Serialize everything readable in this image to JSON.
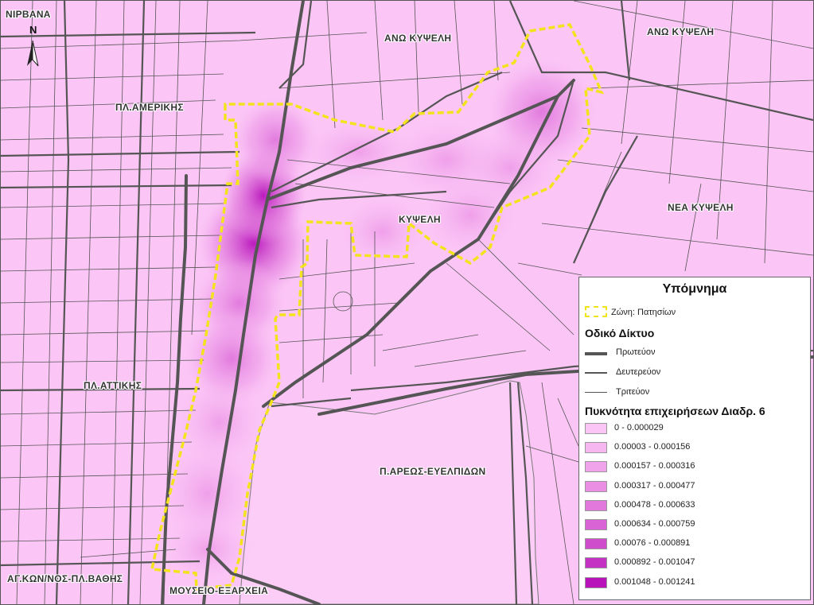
{
  "map": {
    "place_labels": [
      {
        "text": "ΝΙΡΒΑΝΑ",
        "id": "nirvana"
      },
      {
        "text": "ΑΝΩ ΚΥΨΕΛΗ",
        "id": "ano-kypseli-1"
      },
      {
        "text": "ΑΝΩ ΚΥΨΕΛΗ",
        "id": "ano-kypseli-2"
      },
      {
        "text": "ΠΛ.ΑΜΕΡΙΚΗΣ",
        "id": "pl-amerikis"
      },
      {
        "text": "ΚΥΨΕΛΗ",
        "id": "kypseli"
      },
      {
        "text": "ΝΕΑ ΚΥΨΕΛΗ",
        "id": "nea-kypseli"
      },
      {
        "text": "ΠΛ.ΑΤΤΙΚΗΣ",
        "id": "pl-attikis"
      },
      {
        "text": "Π.ΑΡΕΩΣ-ΕΥΕΛΠΙΔΩΝ",
        "id": "p-areos"
      },
      {
        "text": "ΑΓ.ΚΩΝ/ΝΟΣ-ΠΛ.ΒΑΘΗΣ",
        "id": "ag-konstantinos"
      },
      {
        "text": "ΜΟΥΣΕΙΟ-ΕΞΑΡΧΕΙΑ",
        "id": "mouseio-exarcheia"
      }
    ],
    "north_arrow_label": "N",
    "colors": {
      "base": "#fbc6f6",
      "zone_outline": "#f2e31d",
      "road": "#555555"
    }
  },
  "legend": {
    "title": "Υπόμνημα",
    "zone_label": "Ζώνη: Πατησίων",
    "network_title": "Οδικό Δίκτυο",
    "road_types": [
      "Πρωτεύον",
      "Δευτερεύον",
      "Τριτεύον"
    ],
    "density_title": "Πυκνότητα επιχειρήσεων Διαδρ. 6",
    "density_classes": [
      {
        "label": "0 - 0.000029",
        "color": "#fbc6f6"
      },
      {
        "label": "0.00003 - 0.000156",
        "color": "#f6b6f0"
      },
      {
        "label": "0.000157 - 0.000316",
        "color": "#f0a2ea"
      },
      {
        "label": "0.000317 - 0.000477",
        "color": "#ea8ee4"
      },
      {
        "label": "0.000478 - 0.000633",
        "color": "#e277dc"
      },
      {
        "label": "0.000634 - 0.000759",
        "color": "#d962d5"
      },
      {
        "label": "0.00076 - 0.000891",
        "color": "#cf4ccd"
      },
      {
        "label": "0.000892 - 0.001047",
        "color": "#c432c4"
      },
      {
        "label": "0.001048 - 0.001241",
        "color": "#b812bb"
      }
    ]
  }
}
